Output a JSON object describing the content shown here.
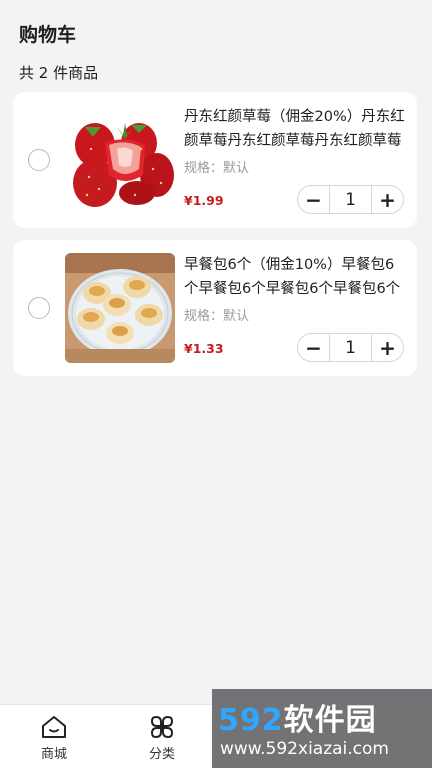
{
  "header": {
    "title": "购物车",
    "count_text": "共 2 件商品"
  },
  "cart_items": [
    {
      "name": "丹东红颜草莓（佣金20%）丹东红颜草莓丹东红颜草莓丹东红颜草莓",
      "spec": "规格：默认",
      "price": "¥1.99",
      "quantity": "1",
      "selected": false,
      "image_icon": "strawberry-image"
    },
    {
      "name": "早餐包6个（佣金10%）早餐包6个早餐包6个早餐包6个早餐包6个",
      "spec": "规格：默认",
      "price": "¥1.33",
      "quantity": "1",
      "selected": false,
      "image_icon": "breakfast-buns-image"
    }
  ],
  "stepper": {
    "minus": "−",
    "plus": "+"
  },
  "tabbar": {
    "items": [
      {
        "label": "商城",
        "icon": "home-icon"
      },
      {
        "label": "分类",
        "icon": "category-icon"
      }
    ]
  },
  "watermark": {
    "digits": "592",
    "text": "软件园",
    "url": "www.592xiazai.com"
  },
  "colors": {
    "price": "#c41d1d",
    "background": "#f1f3f5",
    "watermark_blue": "#2fa6ff"
  }
}
